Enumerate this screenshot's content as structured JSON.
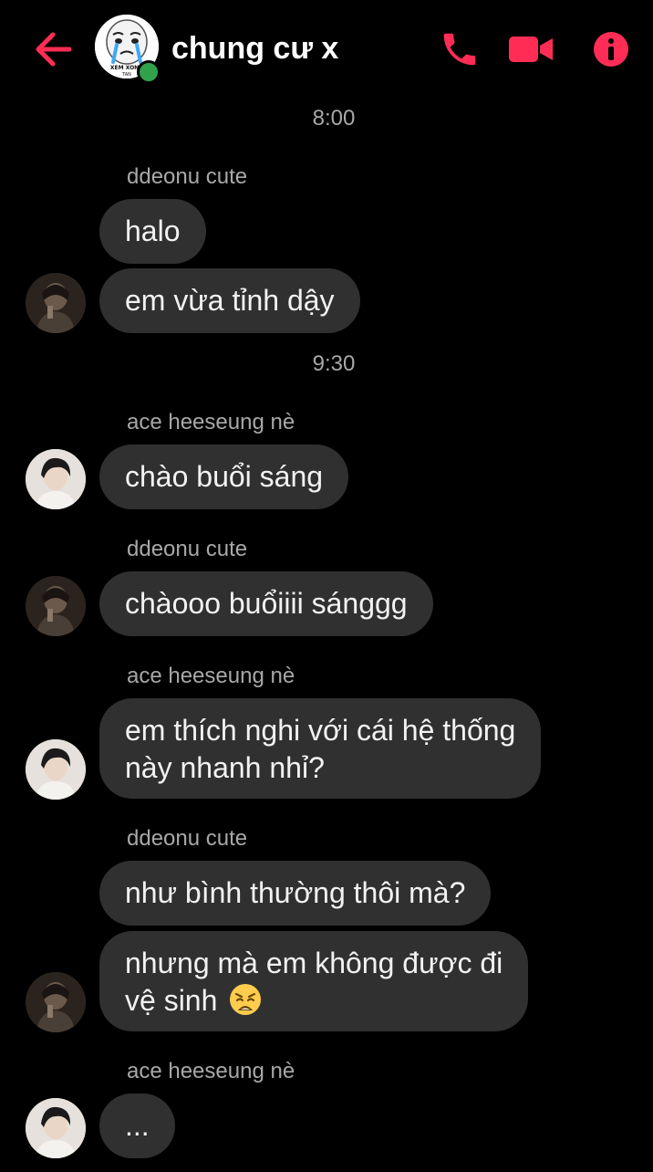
{
  "header": {
    "title": "chung cư x",
    "avatar_text_top": "XEM XONG",
    "avatar_text_bottom": "TAN"
  },
  "colors": {
    "accent": "#ff2d55",
    "bubble": "#303030",
    "online": "#31a24c",
    "meta_text": "#a8a8a8"
  },
  "messages": {
    "time1": "8:00",
    "sender1": "ddeonu cute",
    "m1": "halo",
    "m2": "em vừa tỉnh dậy",
    "time2": "9:30",
    "sender2": "ace heeseung nè",
    "m3": "chào buổi sáng",
    "sender3": "ddeonu cute",
    "m4": "chàooo buổiiii sánggg",
    "sender4": "ace heeseung nè",
    "m5_line1": "em thích nghi với cái hệ thống",
    "m5_line2": "này nhanh nhỉ?",
    "sender5": "ddeonu cute",
    "m6": "như bình thường thôi mà?",
    "m7_line1": "nhưng mà em không được đi",
    "m7_line2": "vệ sinh",
    "m7_emoji": "weary-face-emoji",
    "sender6": "ace heeseung nè",
    "m8": "..."
  }
}
